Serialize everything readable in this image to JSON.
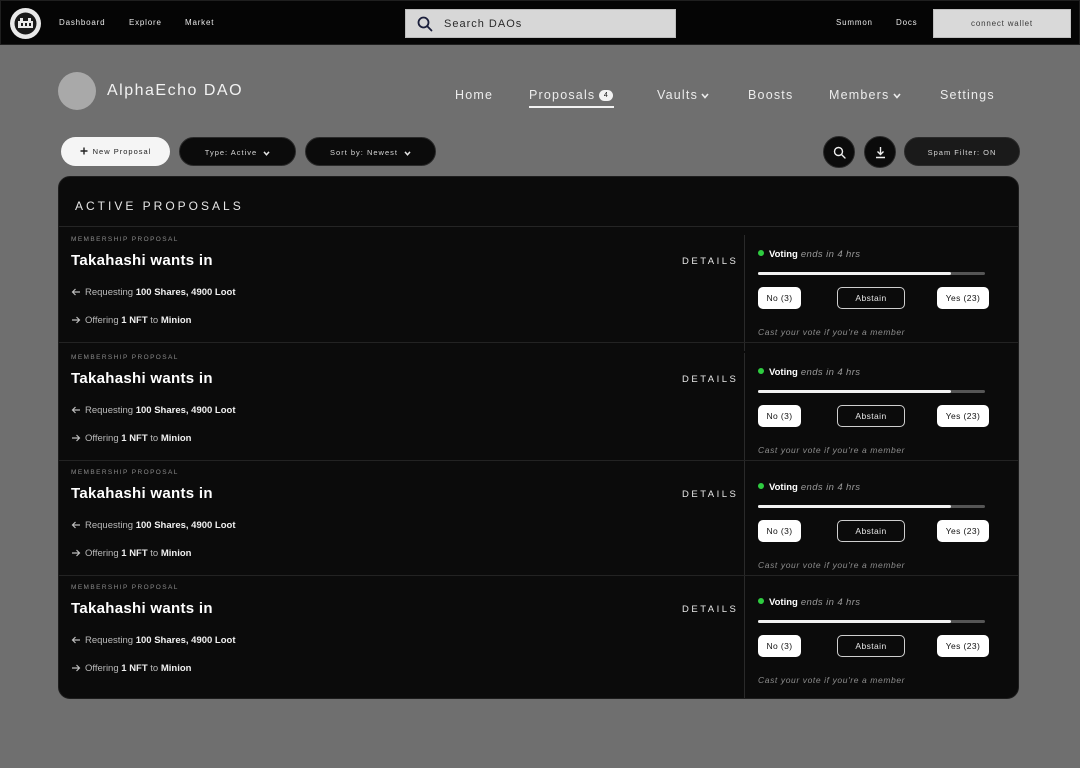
{
  "topbar": {
    "nav": [
      "Dashboard",
      "Explore",
      "Market"
    ],
    "search_placeholder": "Search DAOs",
    "right_links": [
      "Summon",
      "Docs"
    ],
    "wallet_label": "connect wallet"
  },
  "dao": {
    "name": "AlphaEcho DAO",
    "nav": [
      {
        "label": "Home",
        "active": false
      },
      {
        "label": "Proposals",
        "badge": "4",
        "active": true
      },
      {
        "label": "Vaults",
        "dropdown": true
      },
      {
        "label": "Boosts"
      },
      {
        "label": "Members",
        "dropdown": true
      },
      {
        "label": "Settings"
      }
    ]
  },
  "toolbar": {
    "new_proposal": "New Proposal",
    "type_filter": "Type: Active",
    "sort": "Sort by: Newest",
    "spam_filter": "Spam Filter: ON"
  },
  "panel": {
    "title": "ACTIVE PROPOSALS",
    "proposals": [
      {
        "kind": "MEMBERSHIP PROPOSAL",
        "title": "Takahashi wants in",
        "requesting_prefix": "Requesting",
        "requesting_value": "100 Shares, 4900 Loot",
        "offering_prefix": "Offering",
        "offering_value": "1 NFT",
        "offering_to": "to",
        "offering_target": "Minion",
        "details": "DETAILS",
        "voting_label": "Voting",
        "voting_ends": "ends in 4 hrs",
        "progress": 0.85,
        "no": "No (3)",
        "abstain": "Abstain",
        "yes": "Yes (23)",
        "hint": "Cast your vote if you're a member"
      },
      {
        "kind": "MEMBERSHIP PROPOSAL",
        "title": "Takahashi wants in",
        "requesting_prefix": "Requesting",
        "requesting_value": "100 Shares, 4900 Loot",
        "offering_prefix": "Offering",
        "offering_value": "1 NFT",
        "offering_to": "to",
        "offering_target": "Minion",
        "details": "DETAILS",
        "voting_label": "Voting",
        "voting_ends": "ends in 4 hrs",
        "progress": 0.85,
        "no": "No (3)",
        "abstain": "Abstain",
        "yes": "Yes (23)",
        "hint": "Cast your vote if you're a member"
      },
      {
        "kind": "MEMBERSHIP PROPOSAL",
        "title": "Takahashi wants in",
        "requesting_prefix": "Requesting",
        "requesting_value": "100 Shares, 4900 Loot",
        "offering_prefix": "Offering",
        "offering_value": "1 NFT",
        "offering_to": "to",
        "offering_target": "Minion",
        "details": "DETAILS",
        "voting_label": "Voting",
        "voting_ends": "ends in 4 hrs",
        "progress": 0.85,
        "no": "No (3)",
        "abstain": "Abstain",
        "yes": "Yes (23)",
        "hint": "Cast your vote if you're a member"
      },
      {
        "kind": "MEMBERSHIP PROPOSAL",
        "title": "Takahashi wants in",
        "requesting_prefix": "Requesting",
        "requesting_value": "100 Shares, 4900 Loot",
        "offering_prefix": "Offering",
        "offering_value": "1 NFT",
        "offering_to": "to",
        "offering_target": "Minion",
        "details": "DETAILS",
        "voting_label": "Voting",
        "voting_ends": "ends in 4 hrs",
        "progress": 0.85,
        "no": "No (3)",
        "abstain": "Abstain",
        "yes": "Yes (23)",
        "hint": "Cast your vote if you're a member"
      }
    ]
  },
  "colors": {
    "background": "#6f6f6f",
    "panel": "#0b0b0b",
    "voting_dot": "#2ecc40"
  },
  "icons": [
    "dao-logo-icon",
    "search-icon",
    "plus-icon",
    "chevron-down-icon",
    "download-icon",
    "arrow-left-icon",
    "arrow-right-icon"
  ]
}
